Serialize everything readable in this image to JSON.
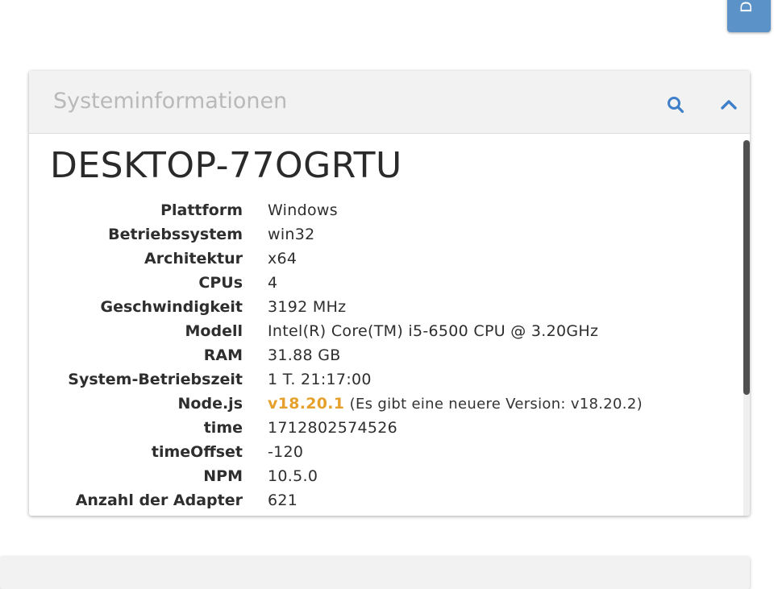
{
  "doc_tab": {
    "label": "DO",
    "color": "#5b93c8"
  },
  "card": {
    "title": "Systeminformationen",
    "search_icon": "search-icon",
    "collapse_icon": "chevron-up-icon",
    "accent_color": "#3d7fc8"
  },
  "host": {
    "name": "DESKTOP-77OGRTU"
  },
  "info": [
    {
      "label": "Plattform",
      "value": "Windows"
    },
    {
      "label": "Betriebssystem",
      "value": "win32"
    },
    {
      "label": "Architektur",
      "value": "x64"
    },
    {
      "label": "CPUs",
      "value": "4"
    },
    {
      "label": "Geschwindigkeit",
      "value": "3192 MHz"
    },
    {
      "label": "Modell",
      "value": "Intel(R) Core(TM) i5-6500 CPU @ 3.20GHz"
    },
    {
      "label": "RAM",
      "value": "31.88 GB"
    },
    {
      "label": "System-Betriebszeit",
      "value": "1 T. 21:17:00"
    },
    {
      "label": "Node.js",
      "value": "v18.20.1",
      "note": "(Es gibt eine neuere Version: v18.20.2)",
      "value_color": "#e5a12c"
    },
    {
      "label": "time",
      "value": "1712802574526"
    },
    {
      "label": "timeOffset",
      "value": "-120"
    },
    {
      "label": "NPM",
      "value": "10.5.0"
    },
    {
      "label": "Anzahl der Adapter",
      "value": "621"
    }
  ]
}
